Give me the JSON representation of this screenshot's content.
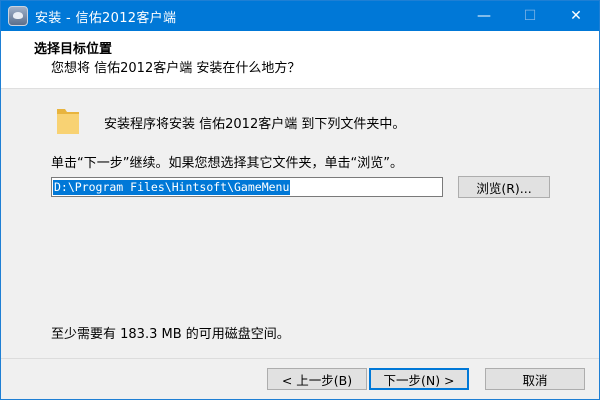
{
  "window": {
    "title": "安装 - 信佑2012客户端",
    "minimize": "—",
    "maximize": "☐",
    "close": "✕"
  },
  "header": {
    "title": "选择目标位置",
    "subtitle": "您想将 信佑2012客户端 安装在什么地方？"
  },
  "main": {
    "line1": "安装程序将安装 信佑2012客户端 到下列文件夹中。",
    "line2": "单击“下一步”继续。如果您想选择其它文件夹，单击“浏览”。",
    "path_value": "D:\\Program Files\\Hintsoft\\GameMenu",
    "browse_label": "浏览(R)...",
    "disk_space": "至少需要有 183.3 MB 的可用磁盘空间。"
  },
  "footer": {
    "back_label": "< 上一步(B)",
    "next_label": "下一步(N) >",
    "cancel_label": "取消"
  },
  "icons": {
    "app": "app-icon",
    "folder": "folder-icon"
  },
  "colors": {
    "titlebar": "#0078d7",
    "selection": "#0078d7",
    "folder": "#f5c85a"
  }
}
